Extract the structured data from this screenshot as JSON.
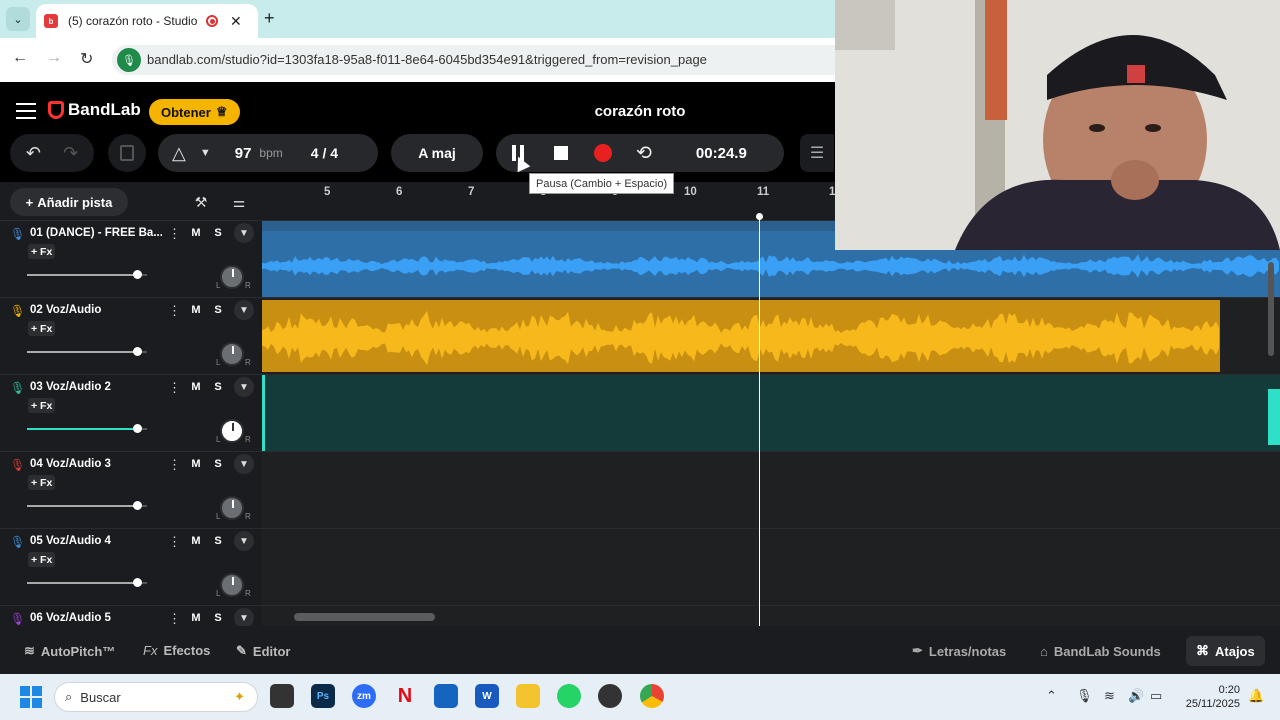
{
  "browser": {
    "tab_title": "(5) corazón roto - Studio",
    "tab_close": "✕",
    "new_tab": "+",
    "url": "bandlab.com/studio?id=1303fa18-95a8-f011-8e64-6045bd354e91&triggered_from=revision_page"
  },
  "app": {
    "logo_text": "BandLab",
    "get_button": "Obtener",
    "project_title": "corazón roto",
    "bpm_value": "97",
    "bpm_unit": "bpm",
    "time_signature": "4 / 4",
    "key": "A maj",
    "time_display": "00:24.9",
    "pause_tooltip": "Pausa (Cambio + Espacio)",
    "add_track": "Añadir pista",
    "accent_color": "#f5b400"
  },
  "ruler": {
    "bars": [
      "5",
      "6",
      "7",
      "8",
      "9",
      "10",
      "11",
      "1"
    ]
  },
  "tracks": [
    {
      "name": "01  (DANCE) - FREE Ba...",
      "mute": "M",
      "solo": "S",
      "fx": "+ Fx",
      "color": "#3a8fe0",
      "volume": 0.92,
      "pan": 0
    },
    {
      "name": "02  Voz/Audio",
      "mute": "M",
      "solo": "S",
      "fx": "+ Fx",
      "color": "#f5b400",
      "volume": 0.92,
      "pan": 0
    },
    {
      "name": "03  Voz/Audio 2",
      "mute": "M",
      "solo": "S",
      "fx": "+ Fx",
      "color": "#2fc1a4",
      "volume": 0.92,
      "pan": 0
    },
    {
      "name": "04  Voz/Audio 3",
      "mute": "M",
      "solo": "S",
      "fx": "+ Fx",
      "color": "#e23b3b",
      "volume": 0.92,
      "pan": 0
    },
    {
      "name": "05  Voz/Audio 4",
      "mute": "M",
      "solo": "S",
      "fx": "+ Fx",
      "color": "#3a8fe0",
      "volume": 0.92,
      "pan": 0
    },
    {
      "name": "06  Voz/Audio 5",
      "mute": "M",
      "solo": "S",
      "fx": "+ Fx",
      "color": "#a040e0",
      "volume": 0.92,
      "pan": 0
    }
  ],
  "bottom": {
    "autopitch": "AutoPitch™",
    "effects_prefix": "Fx",
    "effects": "Efectos",
    "editor": "Editor",
    "lyrics": "Letras/notas",
    "sounds": "BandLab Sounds",
    "shortcuts": "Atajos"
  },
  "taskbar": {
    "search_placeholder": "Buscar",
    "time": "0:20",
    "date": "25/11/2025",
    "ps_label": "Ps",
    "zm_label": "zm",
    "netflix_label": "N",
    "word_label": "W"
  },
  "icons": {
    "tab_list": "chevron-down-icon",
    "back": "back-arrow-icon",
    "forward": "forward-arrow-icon",
    "reload": "reload-icon",
    "undo": "undo-icon",
    "redo": "redo-icon",
    "pause": "pause-icon",
    "stop": "stop-icon",
    "record": "record-icon",
    "loop": "loop-icon",
    "mixer": "mixer-icon"
  }
}
